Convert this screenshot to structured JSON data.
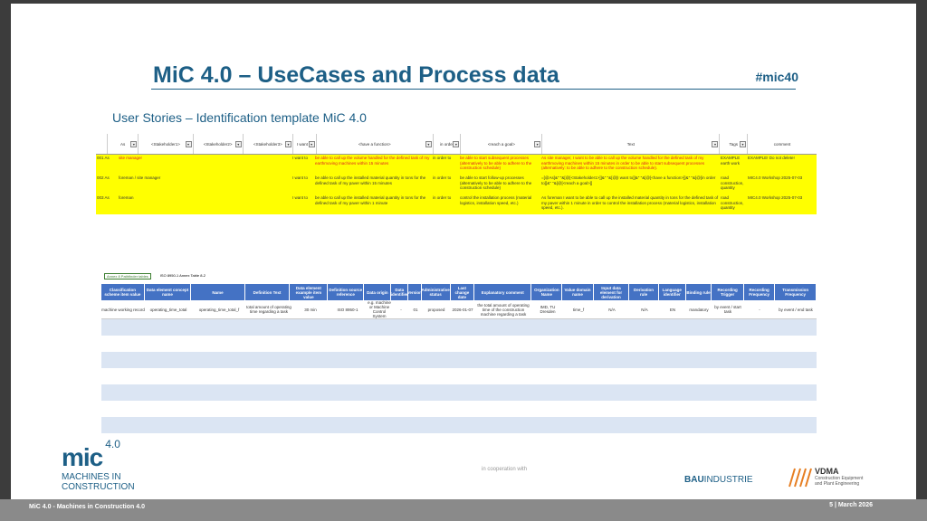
{
  "slide": {
    "title": "MiC 4.0 – UseCases and Process data",
    "hashtag": "#mic40",
    "subtitle": "User Stories – Identification template MiC 4.0"
  },
  "sheet1": {
    "headers": [
      "",
      "As",
      "<Stakeholder1>",
      "<Stakeholder2>",
      "<Stakeholder3>",
      "I want to",
      "<have a function>",
      "in order",
      "<reach a goal>",
      "Text",
      "Tags",
      "comment"
    ],
    "rows": [
      [
        "001 As",
        "site manager",
        "",
        "",
        "I want to",
        "be able to call up the volume handled for the defined task of my earthmoving machines within 15 minutes",
        "in order to",
        "be able to start subsequent processes (alternatively to be able to adhere to the construction schedule)",
        "As site manager, I want to be able to call up the volume handled for the defined task of my earthmoving machines within 15 minutes in order to be able to start subsequent processes (alternatively: to be able to adhere to the construction schedule).",
        "EXAMPLE earth work",
        "EXAMPLE! Do not delete!"
      ],
      [
        "002 As",
        "foreman / site manager",
        "",
        "",
        "I want to",
        "be able to call up the installed material quantity in tons for the defined task of my paver within 15 minutes",
        "in order to",
        "be able to start follow-up processes (alternatively to be able to adhere to the construction schedule)",
        "=[@As]&\" \"&[@[<Stakeholder1>]]&\" \"&[@[I want to]]&\" \"&[@[<have a function>]]&\" \"&[@[in order to]]&\" \"&[@[<reach a goal>]]",
        "road construction, quantity",
        "MIC4.0 Workshop 2025-07-03"
      ],
      [
        "003 As",
        "foreman",
        "",
        "",
        "I want to",
        "be able to call up the installed material quantity in tons for the defined task of my paver within 1 minute",
        "in order to",
        "control the installation process (material logistics, installation speed, etc.)",
        "As foreman I want to be able to call up the installed material quantity in tons for the defined task of my paver within 1 minute in order to control the installation process (material logistics, installation speed, etc.).",
        "road construction, quantity",
        "MIC4.0 Workshop 2025-07-03"
      ]
    ]
  },
  "sheet2": {
    "tabs": [
      "Annex 8 Pathfinder tables",
      "ISO 8950-1 Annex Table 8-2"
    ],
    "headers": [
      "Classification scheme item value",
      "Data element concept name",
      "Name",
      "Definition Text",
      "Data element example item value",
      "Definition source reference",
      "Data origin",
      "Data identifier",
      "Version",
      "Administrative status",
      "Last change date",
      "Explanatory comment",
      "Organization Name",
      "Value domain name",
      "Input data element for derivation",
      "Derivation rule",
      "Language identifier",
      "Binding rule",
      "Recording Trigger",
      "Recording Frequency",
      "Transmission Frequency"
    ],
    "row": [
      "machine working record",
      "operating_time_total",
      "operating_time_total_f",
      "total amount of operating time regarding a task",
      "30 min",
      "ISO 8950-1",
      "e.g. machine or Machine Control System",
      "-",
      "01",
      "proposed",
      "2026-01-07",
      "the total amount of operating time of the construction machine regarding a task",
      "IMD, TU Dresden",
      "time_f",
      "N/A",
      "N/A",
      "EN",
      "mandatory",
      "by event / start task",
      "-",
      "by event / end task"
    ]
  },
  "footer": {
    "left": "MiC 4.0 -  Machines in Construction 4.0",
    "right": "5 |   March 2026"
  },
  "logos": {
    "mic_mark": "mic",
    "mic_version": "4.0",
    "mic_line1": "MACHINES IN",
    "mic_line2": "CONSTRUCTION",
    "coop": "in cooperation with",
    "bau_a": "BAU",
    "bau_b": "INDUSTRIE",
    "vdma": "VDMA",
    "vdma_sub1": "Construction Equipment",
    "vdma_sub2": "and Plant Engineering"
  }
}
